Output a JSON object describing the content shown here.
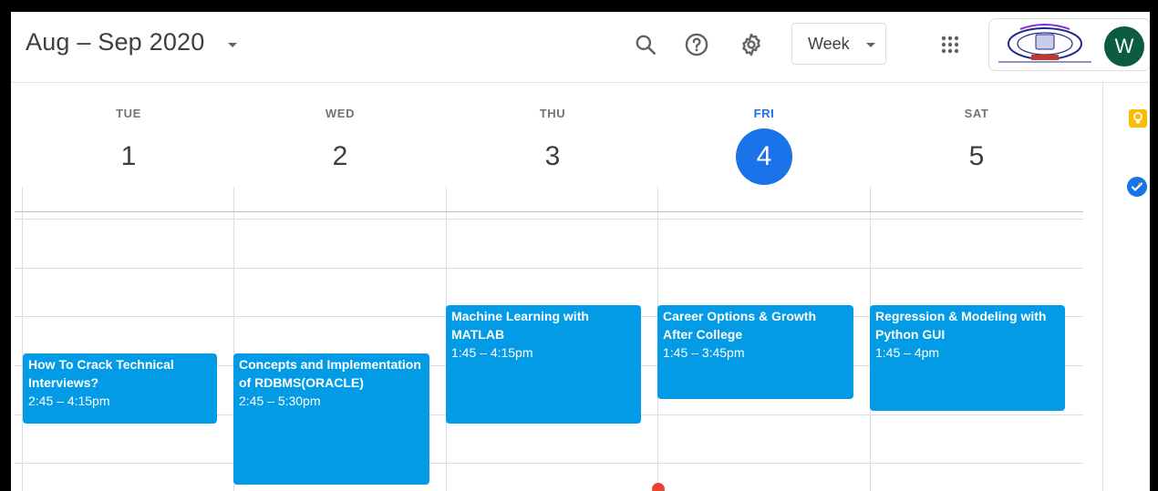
{
  "header": {
    "title": "Aug – Sep 2020",
    "view": "Week",
    "avatar_letter": "W"
  },
  "icons": {
    "search": "search-icon",
    "help": "help-icon",
    "settings": "gear-icon",
    "apps": "apps-grid-icon",
    "keep": "keep-icon",
    "tasks": "tasks-icon"
  },
  "days": [
    {
      "name": "TUE",
      "num": "1",
      "today": false
    },
    {
      "name": "WED",
      "num": "2",
      "today": false
    },
    {
      "name": "THU",
      "num": "3",
      "today": false
    },
    {
      "name": "FRI",
      "num": "4",
      "today": true
    },
    {
      "name": "SAT",
      "num": "5",
      "today": false
    }
  ],
  "events": [
    {
      "title": "How To Crack Technical Interviews?",
      "time": "2:45 – 4:15pm"
    },
    {
      "title": "Concepts and Implementation of RDBMS(ORACLE)",
      "time": "2:45 – 5:30pm"
    },
    {
      "title": "Machine Learning with MATLAB",
      "time": "1:45 – 4:15pm"
    },
    {
      "title": "Career Options & Growth After College",
      "time": "1:45 – 3:45pm"
    },
    {
      "title": "Regression & Modeling with Python GUI",
      "time": "1:45 – 4pm"
    }
  ],
  "colors": {
    "event": "#039be5",
    "today": "#1a73e8",
    "avatar": "#0b5b43",
    "now_indicator": "#ea4335"
  }
}
